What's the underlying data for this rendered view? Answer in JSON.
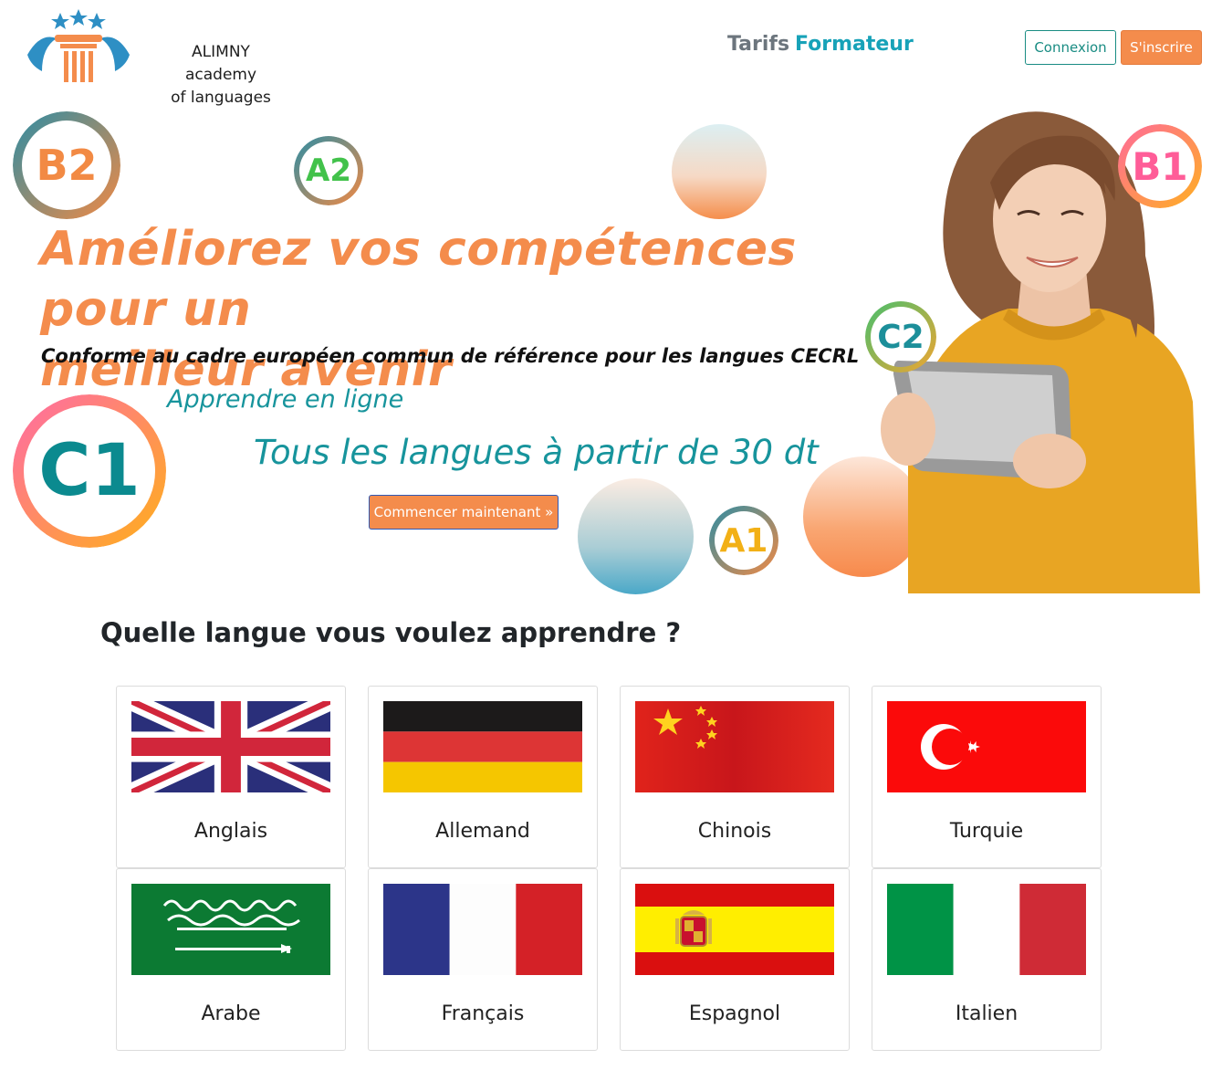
{
  "header": {
    "brand_line1": "ALIMNY academy",
    "brand_line2": "of languages",
    "nav": [
      "Tarifs",
      "Formateur"
    ],
    "login_label": "Connexion",
    "signup_label": "S'inscrire"
  },
  "hero": {
    "levels": [
      "B2",
      "A2",
      "B1",
      "C2",
      "C1",
      "A1"
    ],
    "title_line1": "Améliorez vos compétences pour un",
    "title_line2": "meilleur avenir",
    "subtitle": "Conforme au cadre européen commun de référence pour les langues CECRL",
    "online": "Apprendre en ligne",
    "price": "Tous les langues à partir de 30 dt",
    "cta_label": "Commencer maintenant »"
  },
  "languages": {
    "title": "Quelle langue vous voulez apprendre ?",
    "items": [
      {
        "label": "Anglais",
        "flag": "uk"
      },
      {
        "label": "Allemand",
        "flag": "germany"
      },
      {
        "label": "Chinois",
        "flag": "china"
      },
      {
        "label": "Turquie",
        "flag": "turkey"
      },
      {
        "label": "Arabe",
        "flag": "saudi-arabia"
      },
      {
        "label": "Français",
        "flag": "france"
      },
      {
        "label": "Espagnol",
        "flag": "spain"
      },
      {
        "label": "Italien",
        "flag": "italy"
      }
    ]
  },
  "colors": {
    "accent_orange": "#f48c4c",
    "accent_teal": "#17949c",
    "nav_grey": "#6c757d"
  }
}
